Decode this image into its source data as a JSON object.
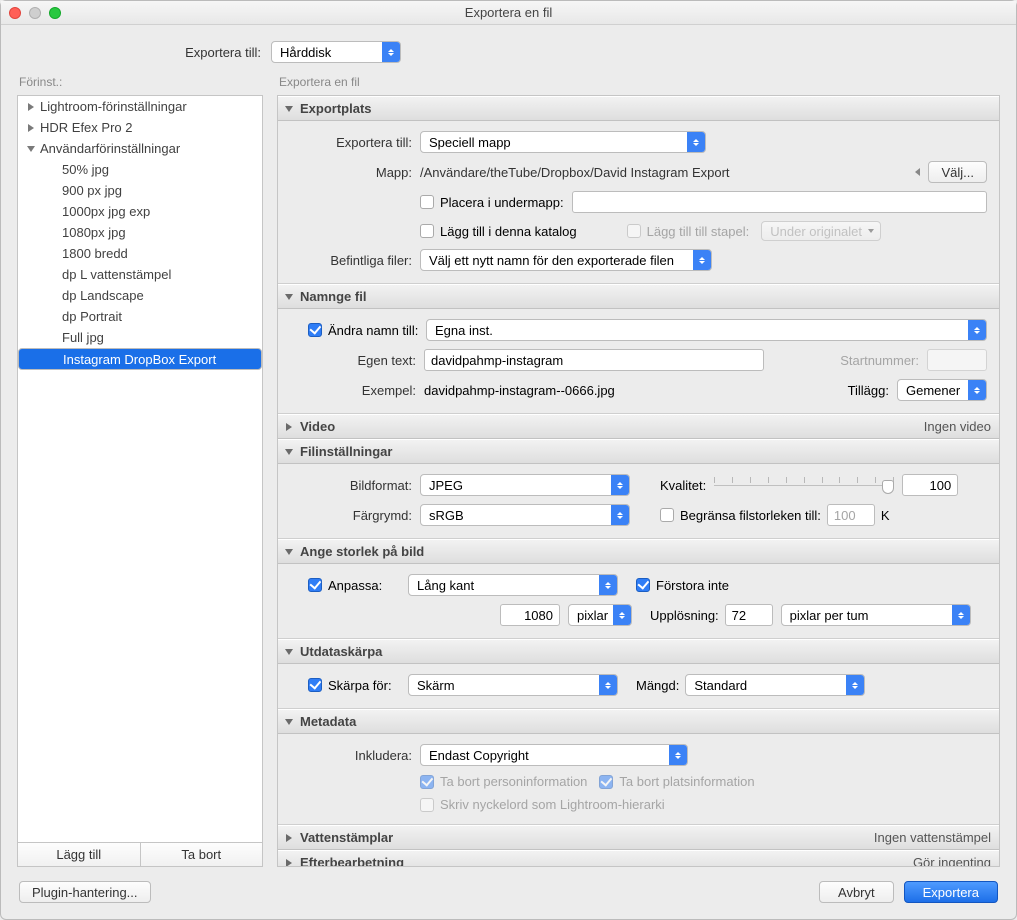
{
  "window": {
    "title": "Exportera en fil"
  },
  "toprow": {
    "label": "Exportera till:",
    "value": "Hårddisk"
  },
  "left": {
    "heading": "Förinst.:",
    "groups": [
      {
        "label": "Lightroom-förinställningar",
        "open": false
      },
      {
        "label": "HDR Efex Pro 2",
        "open": false
      },
      {
        "label": "Användarförinställningar",
        "open": true
      }
    ],
    "children": [
      "50% jpg",
      "900 px jpg",
      "1000px jpg exp",
      "1080px jpg",
      "1800 bredd",
      "dp L vattenstämpel",
      "dp Landscape",
      "dp Portrait",
      "Full jpg",
      "Instagram DropBox Export"
    ],
    "selected_index": 9,
    "add": "Lägg till",
    "remove": "Ta bort"
  },
  "right_heading": "Exportera en fil",
  "exportplats": {
    "title": "Exportplats",
    "exportera_label": "Exportera till:",
    "exportera_value": "Speciell mapp",
    "mapp_label": "Mapp:",
    "mapp_value": "/Användare/theTube/Dropbox/David Instagram Export",
    "valj": "Välj...",
    "placera_label": "Placera i undermapp:",
    "lagg_katalog": "Lägg till i denna katalog",
    "lagg_stapel": "Lägg till till stapel:",
    "stapel_value": "Under originalet",
    "befintliga_label": "Befintliga filer:",
    "befintliga_value": "Välj ett nytt namn för den exporterade filen"
  },
  "namnge": {
    "title": "Namnge fil",
    "andra_label": "Ändra namn till:",
    "andra_value": "Egna inst.",
    "egen_label": "Egen text:",
    "egen_value": "davidpahmp-instagram",
    "start_label": "Startnummer:",
    "exempel_label": "Exempel:",
    "exempel_value": "davidpahmp-instagram--0666.jpg",
    "tillagg_label": "Tillägg:",
    "tillagg_value": "Gemener"
  },
  "video": {
    "title": "Video",
    "right": "Ingen video"
  },
  "filinst": {
    "title": "Filinställningar",
    "bildformat_label": "Bildformat:",
    "bildformat_value": "JPEG",
    "kvalitet_label": "Kvalitet:",
    "kvalitet_value": "100",
    "fargrymd_label": "Färgrymd:",
    "fargrymd_value": "sRGB",
    "begransa_label": "Begränsa filstorleken till:",
    "begransa_value": "100",
    "begransa_unit": "K"
  },
  "storlek": {
    "title": "Ange storlek på bild",
    "anpassa_label": "Anpassa:",
    "anpassa_value": "Lång kant",
    "forstora_label": "Förstora inte",
    "dim_value": "1080",
    "dim_unit": "pixlar",
    "uppl_label": "Upplösning:",
    "uppl_value": "72",
    "uppl_unit": "pixlar per tum"
  },
  "skarpa": {
    "title": "Utdataskärpa",
    "skarpa_label": "Skärpa för:",
    "skarpa_value": "Skärm",
    "mangd_label": "Mängd:",
    "mangd_value": "Standard"
  },
  "metadata": {
    "title": "Metadata",
    "inkl_label": "Inkludera:",
    "inkl_value": "Endast Copyright",
    "person": "Ta bort personinformation",
    "plats": "Ta bort platsinformation",
    "nyckel": "Skriv nyckelord som Lightroom-hierarki"
  },
  "vatten": {
    "title": "Vattenstämplar",
    "right": "Ingen vattenstämpel"
  },
  "efter": {
    "title": "Efterbearbetning",
    "right": "Gör ingenting"
  },
  "footer": {
    "plugin": "Plugin-hantering...",
    "cancel": "Avbryt",
    "export": "Exportera"
  }
}
